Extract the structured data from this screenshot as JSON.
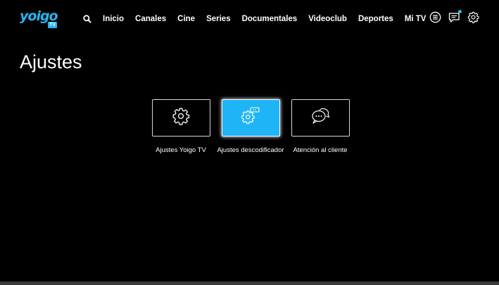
{
  "logo": {
    "word": "yoigo",
    "badge": "TV",
    "color": "#27b5f0"
  },
  "header": {
    "nav": [
      "Inicio",
      "Canales",
      "Cine",
      "Series",
      "Documentales",
      "Videoclub",
      "Deportes",
      "Mi TV"
    ],
    "icons": [
      "search-icon",
      "guide-list-icon",
      "messages-icon",
      "settings-icon"
    ],
    "notification_color": "#27b5f0"
  },
  "page": {
    "title": "Ajustes"
  },
  "cards": [
    {
      "label": "Ajustes Yoigo TV",
      "icon": "gear-icon",
      "selected": false
    },
    {
      "label": "Ajustes descodificador",
      "icon": "decoder-settings-icon",
      "selected": true
    },
    {
      "label": "Atención al cliente",
      "icon": "chat-bubbles-icon",
      "selected": false
    }
  ],
  "colors": {
    "accent": "#1fb4f6",
    "background": "#000000"
  }
}
